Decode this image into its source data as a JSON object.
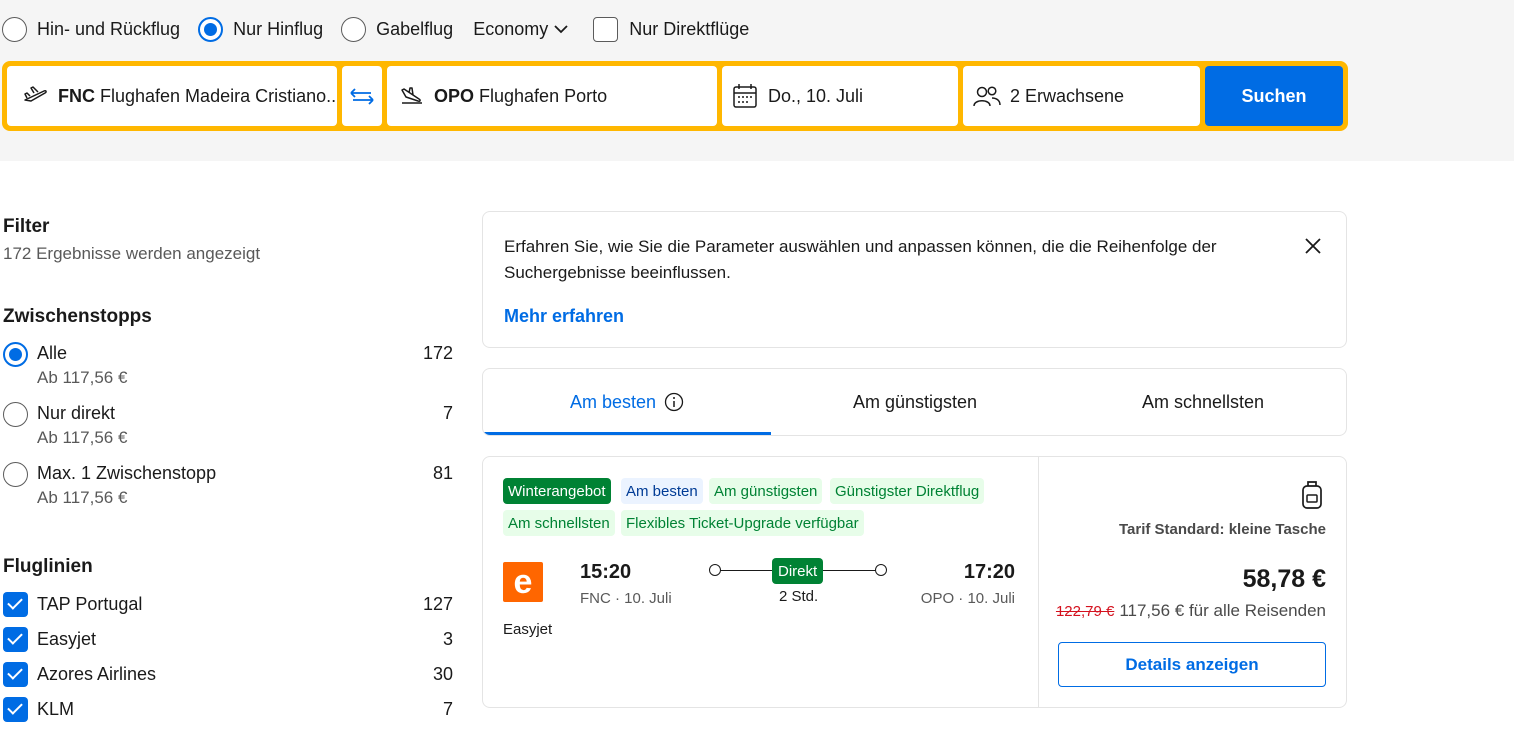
{
  "trip_types": [
    {
      "label": "Hin- und Rückflug",
      "selected": false
    },
    {
      "label": "Nur Hinflug",
      "selected": true
    },
    {
      "label": "Gabelflug",
      "selected": false
    }
  ],
  "cabin_class": "Economy",
  "direct_only": {
    "label": "Nur Direktflüge",
    "checked": false
  },
  "search": {
    "origin_code": "FNC",
    "origin_name": "Flughafen Madeira Cristiano...",
    "destination_code": "OPO",
    "destination_name": "Flughafen Porto",
    "date": "Do., 10. Juli",
    "travellers": "2 Erwachsene",
    "button": "Suchen"
  },
  "filters": {
    "title": "Filter",
    "result_count": "172 Ergebnisse werden angezeigt",
    "stops": {
      "title": "Zwischenstopps",
      "options": [
        {
          "label": "Alle",
          "count": "172",
          "price": "Ab 117,56 €",
          "selected": true
        },
        {
          "label": "Nur direkt",
          "count": "7",
          "price": "Ab 117,56 €",
          "selected": false
        },
        {
          "label": "Max. 1 Zwischenstopp",
          "count": "81",
          "price": "Ab 117,56 €",
          "selected": false
        }
      ]
    },
    "airlines": {
      "title": "Fluglinien",
      "options": [
        {
          "label": "TAP Portugal",
          "count": "127",
          "checked": true
        },
        {
          "label": "Easyjet",
          "count": "3",
          "checked": true
        },
        {
          "label": "Azores Airlines",
          "count": "30",
          "checked": true
        },
        {
          "label": "KLM",
          "count": "7",
          "checked": true
        }
      ]
    }
  },
  "info": {
    "text": "Erfahren Sie, wie Sie die Parameter auswählen und anpassen können, die die Reihenfolge der Suchergebnisse beeinflussen.",
    "link": "Mehr erfahren"
  },
  "sort_tabs": [
    {
      "label": "Am besten",
      "active": true
    },
    {
      "label": "Am günstigsten",
      "active": false
    },
    {
      "label": "Am schnellsten",
      "active": false
    }
  ],
  "result": {
    "badges": [
      "Winterangebot",
      "Am besten",
      "Am günstigsten",
      "Günstigster Direktflug",
      "Am schnellsten",
      "Flexibles Ticket-Upgrade verfügbar"
    ],
    "airline_logo_letter": "e",
    "airline": "Easyjet",
    "depart_time": "15:20",
    "depart_place": "FNC · 10. Juli",
    "arrive_time": "17:20",
    "arrive_place": "OPO · 10. Juli",
    "stops_label": "Direkt",
    "duration": "2 Std.",
    "fare": "Tarif Standard: kleine Tasche",
    "price": "58,78 €",
    "old_price": "122,79 €",
    "total_price": "117,56 € für alle Reisenden",
    "details_button": "Details anzeigen"
  },
  "colors": {
    "brand_blue": "#006ce4",
    "search_border": "#ffb700",
    "green_badge": "#008234",
    "easyjet_orange": "#ff6600"
  }
}
